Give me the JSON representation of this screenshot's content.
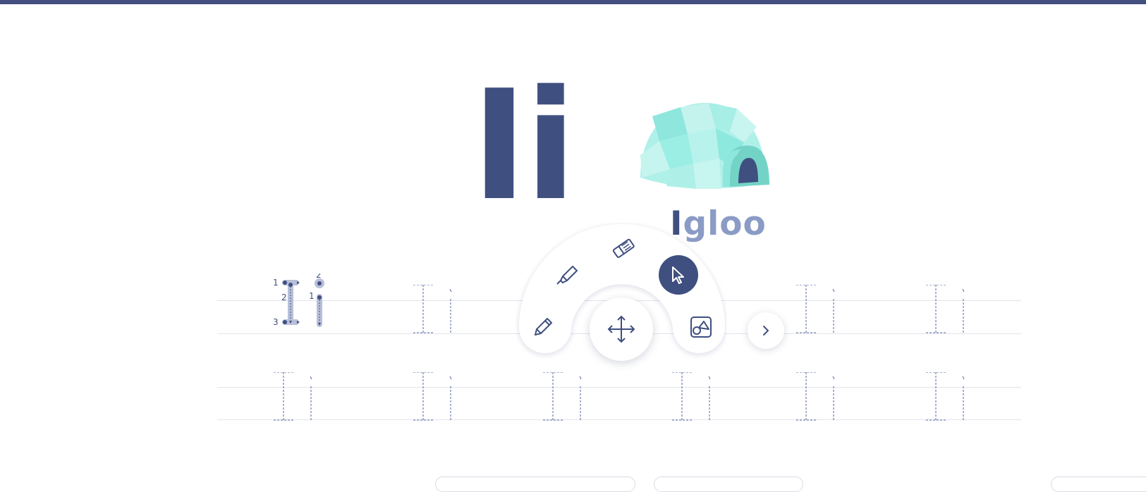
{
  "letters": {
    "upper": "I",
    "lower": "i"
  },
  "word": {
    "first_letter": "I",
    "rest": "gloo"
  },
  "picture": {
    "icon": "igloo-icon"
  },
  "model_stroke_numbers": {
    "upper_1": "1",
    "upper_2": "2",
    "upper_3": "3",
    "lower_1": "1",
    "lower_2": "2"
  },
  "toolbar": {
    "tools": [
      {
        "name": "pencil",
        "icon": "pencil-icon"
      },
      {
        "name": "highlighter",
        "icon": "highlighter-icon"
      },
      {
        "name": "eraser",
        "icon": "eraser-icon"
      },
      {
        "name": "pointer",
        "icon": "cursor-icon",
        "active": true
      },
      {
        "name": "shapes",
        "icon": "shapes-icon"
      },
      {
        "name": "move",
        "icon": "move-icon"
      }
    ],
    "next_icon": "chevron-right-icon"
  },
  "colors": {
    "primary": "#3f4f80",
    "secondary": "#8a9bc5",
    "guide_line": "#e3e5ec",
    "igloo_light": "#bff0ea",
    "igloo_mid": "#96ece3",
    "igloo_dark": "#6ccfc4"
  }
}
